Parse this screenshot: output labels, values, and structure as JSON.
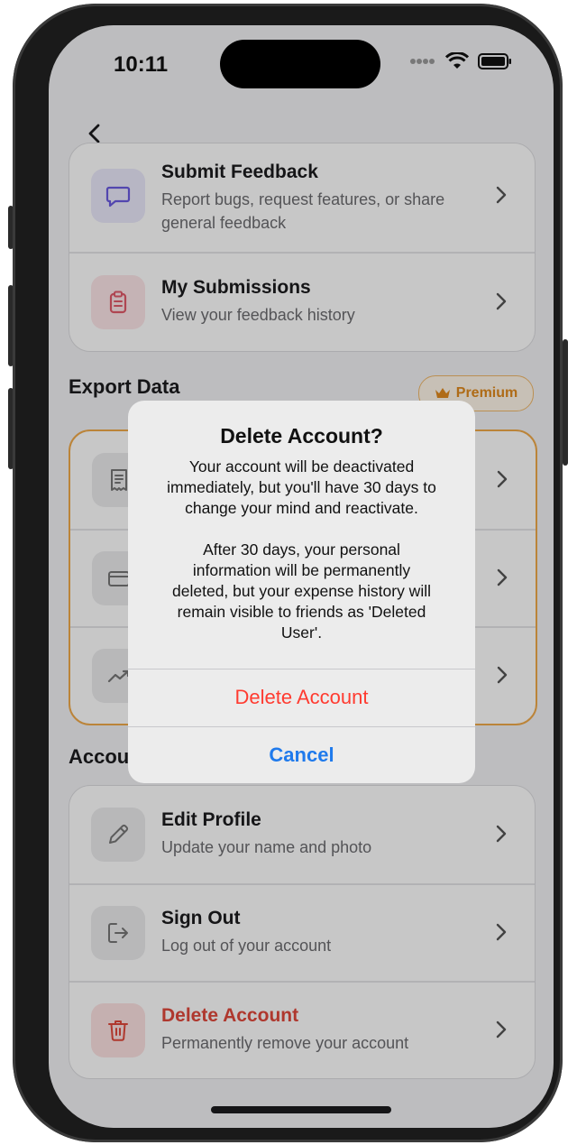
{
  "status_bar": {
    "time": "10:11"
  },
  "feedback": [
    {
      "title": "Submit Feedback",
      "subtitle_lines": [
        "Report bugs, request features, or share",
        "general feedback"
      ]
    },
    {
      "title": "My Submissions",
      "subtitle": "View your feedback history"
    }
  ],
  "export": {
    "header": "Export Data",
    "badge": "Premium"
  },
  "account": {
    "header": "Account",
    "items": [
      {
        "title": "Edit Profile",
        "subtitle": "Update your name and photo"
      },
      {
        "title": "Sign Out",
        "subtitle": "Log out of your account"
      },
      {
        "title": "Delete Account",
        "subtitle": "Permanently remove your account"
      }
    ]
  },
  "alert": {
    "title": "Delete Account?",
    "message_lines": [
      "Your account will be deactivated",
      "immediately, but you'll have 30 days to",
      "change your mind and reactivate.",
      "",
      "After 30 days, your personal",
      "information will be permanently",
      "deleted, but your expense history will",
      "remain visible to friends as 'Deleted",
      "User'."
    ],
    "destructive_button": "Delete Account",
    "cancel_button": "Cancel"
  },
  "colors": {
    "accent": "#1f7aec",
    "destructive": "#ff3b30",
    "premium": "#e08a1e"
  }
}
